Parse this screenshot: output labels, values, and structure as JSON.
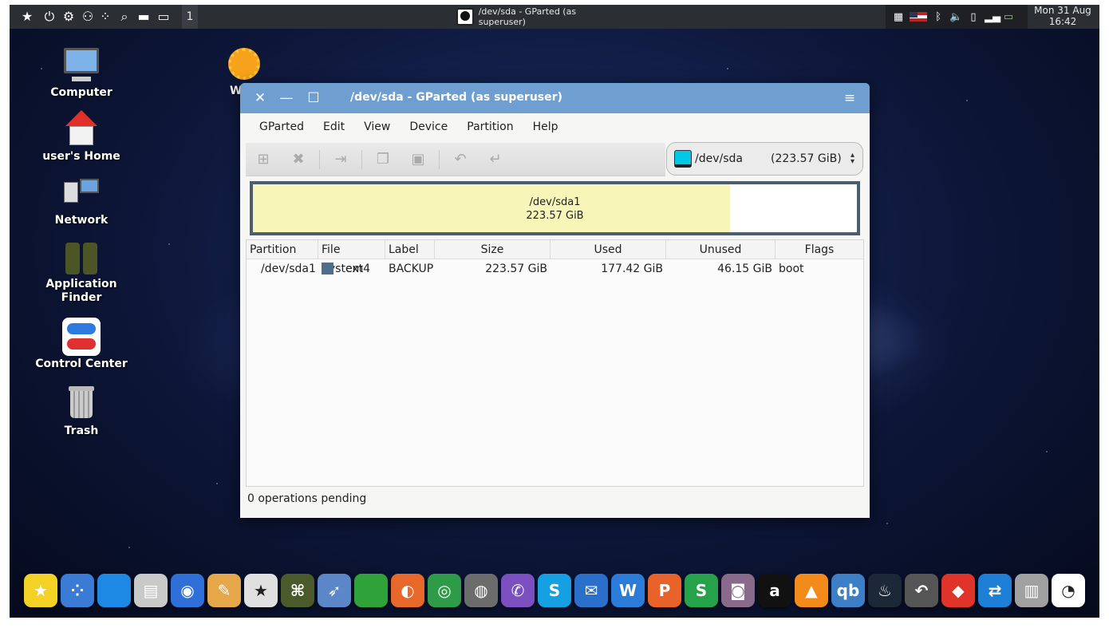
{
  "top_panel": {
    "workspace": "1",
    "task_title": "/dev/sda - GParted (as superuser)",
    "clock_date": "Mon 31 Aug",
    "clock_time": "16:42",
    "launchers": [
      "star-icon",
      "power-icon",
      "settings-icon",
      "binoculars-icon",
      "apps-grid-icon",
      "search-icon",
      "folder-icon",
      "show-desktop-icon"
    ],
    "tray": [
      "keyboard-icon",
      "us-flag-icon",
      "bluetooth-icon",
      "volume-icon",
      "clipboard-icon",
      "signal-icon",
      "battery-icon"
    ]
  },
  "desktop": {
    "icons": [
      {
        "label": "Computer"
      },
      {
        "label": "user's Home"
      },
      {
        "label": "Network"
      },
      {
        "label": "Application Finder"
      },
      {
        "label": "Control Center"
      },
      {
        "label": "Trash"
      },
      {
        "label": "W"
      }
    ]
  },
  "window": {
    "title": "/dev/sda - GParted (as superuser)",
    "menu": [
      "GParted",
      "Edit",
      "View",
      "Device",
      "Partition",
      "Help"
    ],
    "toolbar": [
      "new-partition-icon",
      "delete-icon",
      "apply-icon",
      "copy-icon",
      "paste-icon",
      "undo-icon",
      "redo-icon"
    ],
    "device": {
      "name": "/dev/sda",
      "size": "(223.57 GiB)"
    },
    "map": {
      "partition": "/dev/sda1",
      "size": "223.57 GiB",
      "used_fraction": 0.79
    },
    "columns": [
      "Partition",
      "File System",
      "Label",
      "Size",
      "Used",
      "Unused",
      "Flags"
    ],
    "rows": [
      {
        "partition": "/dev/sda1",
        "fs_color": "#4e6f8c",
        "filesystem": "ext4",
        "label": "BACKUP",
        "size": "223.57 GiB",
        "used": "177.42 GiB",
        "unused": "46.15 GiB",
        "flags": "boot"
      }
    ],
    "status": "0 operations pending"
  },
  "dock": {
    "apps": [
      {
        "name": "favorites",
        "color": "#f3d225",
        "glyph": "★"
      },
      {
        "name": "app-grid",
        "color": "#3a7bd5",
        "glyph": "⁘"
      },
      {
        "name": "desktop",
        "color": "#1e88e5",
        "glyph": ""
      },
      {
        "name": "file-cabinet",
        "color": "#c9c9c9",
        "glyph": "▤"
      },
      {
        "name": "control-center",
        "color": "#2e6fd8",
        "glyph": "◉"
      },
      {
        "name": "appearance",
        "color": "#e6a64a",
        "glyph": "✎"
      },
      {
        "name": "software-store",
        "color": "#e0e0e0",
        "glyph": "★"
      },
      {
        "name": "app-finder",
        "color": "#4a5a2a",
        "glyph": "⌘"
      },
      {
        "name": "rocket",
        "color": "#5b87c9",
        "glyph": "➶"
      },
      {
        "name": "pipe",
        "color": "#2fa23a",
        "glyph": ""
      },
      {
        "name": "firefox",
        "color": "#e8672b",
        "glyph": "◐"
      },
      {
        "name": "chrome",
        "color": "#2e9b48",
        "glyph": "◎"
      },
      {
        "name": "earth-pro",
        "color": "#6c6c6c",
        "glyph": "◍"
      },
      {
        "name": "viber",
        "color": "#7b4fbf",
        "glyph": "✆"
      },
      {
        "name": "skype",
        "color": "#14a0e3",
        "glyph": "S"
      },
      {
        "name": "mail",
        "color": "#2a6fc9",
        "glyph": "✉"
      },
      {
        "name": "writer",
        "color": "#2b7bd9",
        "glyph": "W"
      },
      {
        "name": "presentation",
        "color": "#e8622a",
        "glyph": "P"
      },
      {
        "name": "spreadsheet",
        "color": "#25a24a",
        "glyph": "S"
      },
      {
        "name": "webcam",
        "color": "#8a6a8a",
        "glyph": "◙"
      },
      {
        "name": "a-app",
        "color": "#111111",
        "glyph": "a"
      },
      {
        "name": "vlc",
        "color": "#f28b1a",
        "glyph": "▲"
      },
      {
        "name": "qbittorrent",
        "color": "#3d7fc7",
        "glyph": "qb"
      },
      {
        "name": "steam",
        "color": "#1b2838",
        "glyph": "♨"
      },
      {
        "name": "backup",
        "color": "#555555",
        "glyph": "↶"
      },
      {
        "name": "anydesk",
        "color": "#e0342a",
        "glyph": "◆"
      },
      {
        "name": "teamviewer",
        "color": "#1e7fd6",
        "glyph": "⇄"
      },
      {
        "name": "trash",
        "color": "#a0a0a0",
        "glyph": "▥"
      },
      {
        "name": "gparted",
        "color": "#ffffff",
        "glyph": "◔"
      }
    ]
  }
}
